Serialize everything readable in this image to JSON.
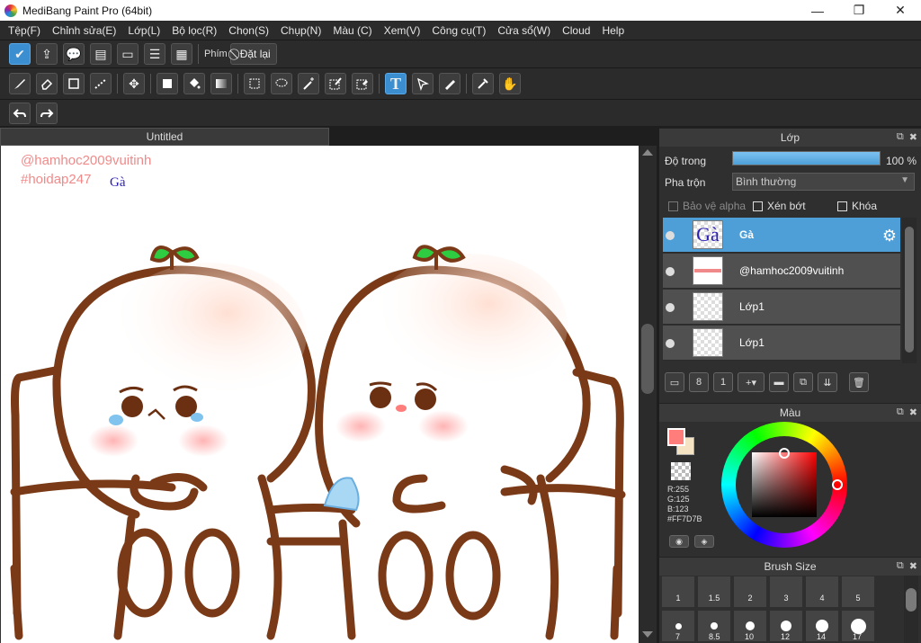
{
  "window": {
    "title": "MediBang Paint Pro (64bit)",
    "minimize": "—",
    "maximize": "❐",
    "close": "✕"
  },
  "menu": [
    "Tệp(F)",
    "Chỉnh sửa(E)",
    "Lớp(L)",
    "Bộ lọc(R)",
    "Chọn(S)",
    "Chụp(N)",
    "Màu (C)",
    "Xem(V)",
    "Công cụ(T)",
    "Cửa sổ(W)",
    "Cloud",
    "Help"
  ],
  "toolbar1": {
    "phim_label": "Phím",
    "reset_label": "Đặt lại"
  },
  "document": {
    "tab_title": "Untitled",
    "watermark_user": "@hamhoc2009vuitinh",
    "watermark_tag": "#hoidap247",
    "text_ga": "Gà"
  },
  "layer_panel": {
    "title": "Lớp",
    "opacity_label": "Độ trong",
    "opacity_value": "100 %",
    "opacity_fraction": 1.0,
    "blend_label": "Pha trộn",
    "blend_value": "Bình thường",
    "alpha_protect": "Bảo vệ alpha",
    "clip": "Xén bớt",
    "lock": "Khóa",
    "layers": [
      {
        "name": "Gà",
        "selected": true,
        "thumb_text": "Gà"
      },
      {
        "name": "@hamhoc2009vuitinh",
        "selected": false,
        "thumb_text": ""
      },
      {
        "name": "Lớp1",
        "selected": false,
        "thumb_text": ""
      },
      {
        "name": "Lớp1",
        "selected": false,
        "thumb_text": ""
      }
    ]
  },
  "color_panel": {
    "title": "Màu",
    "r": "R:255",
    "g": "G:125",
    "b": "B:123",
    "hex": "#FF7D7B",
    "foreground": "#FF7D7B",
    "background": "#F4E4C4"
  },
  "brush_panel": {
    "title": "Brush Size",
    "sizes_row1": [
      "1",
      "1.5",
      "2",
      "3",
      "4",
      "5"
    ],
    "sizes_row2": [
      "7",
      "8.5",
      "10",
      "12",
      "14",
      "17"
    ]
  },
  "colors": {
    "accent": "#4E9FD8",
    "watermark": "#F08A8A",
    "text_blue": "#2A1FB0"
  }
}
